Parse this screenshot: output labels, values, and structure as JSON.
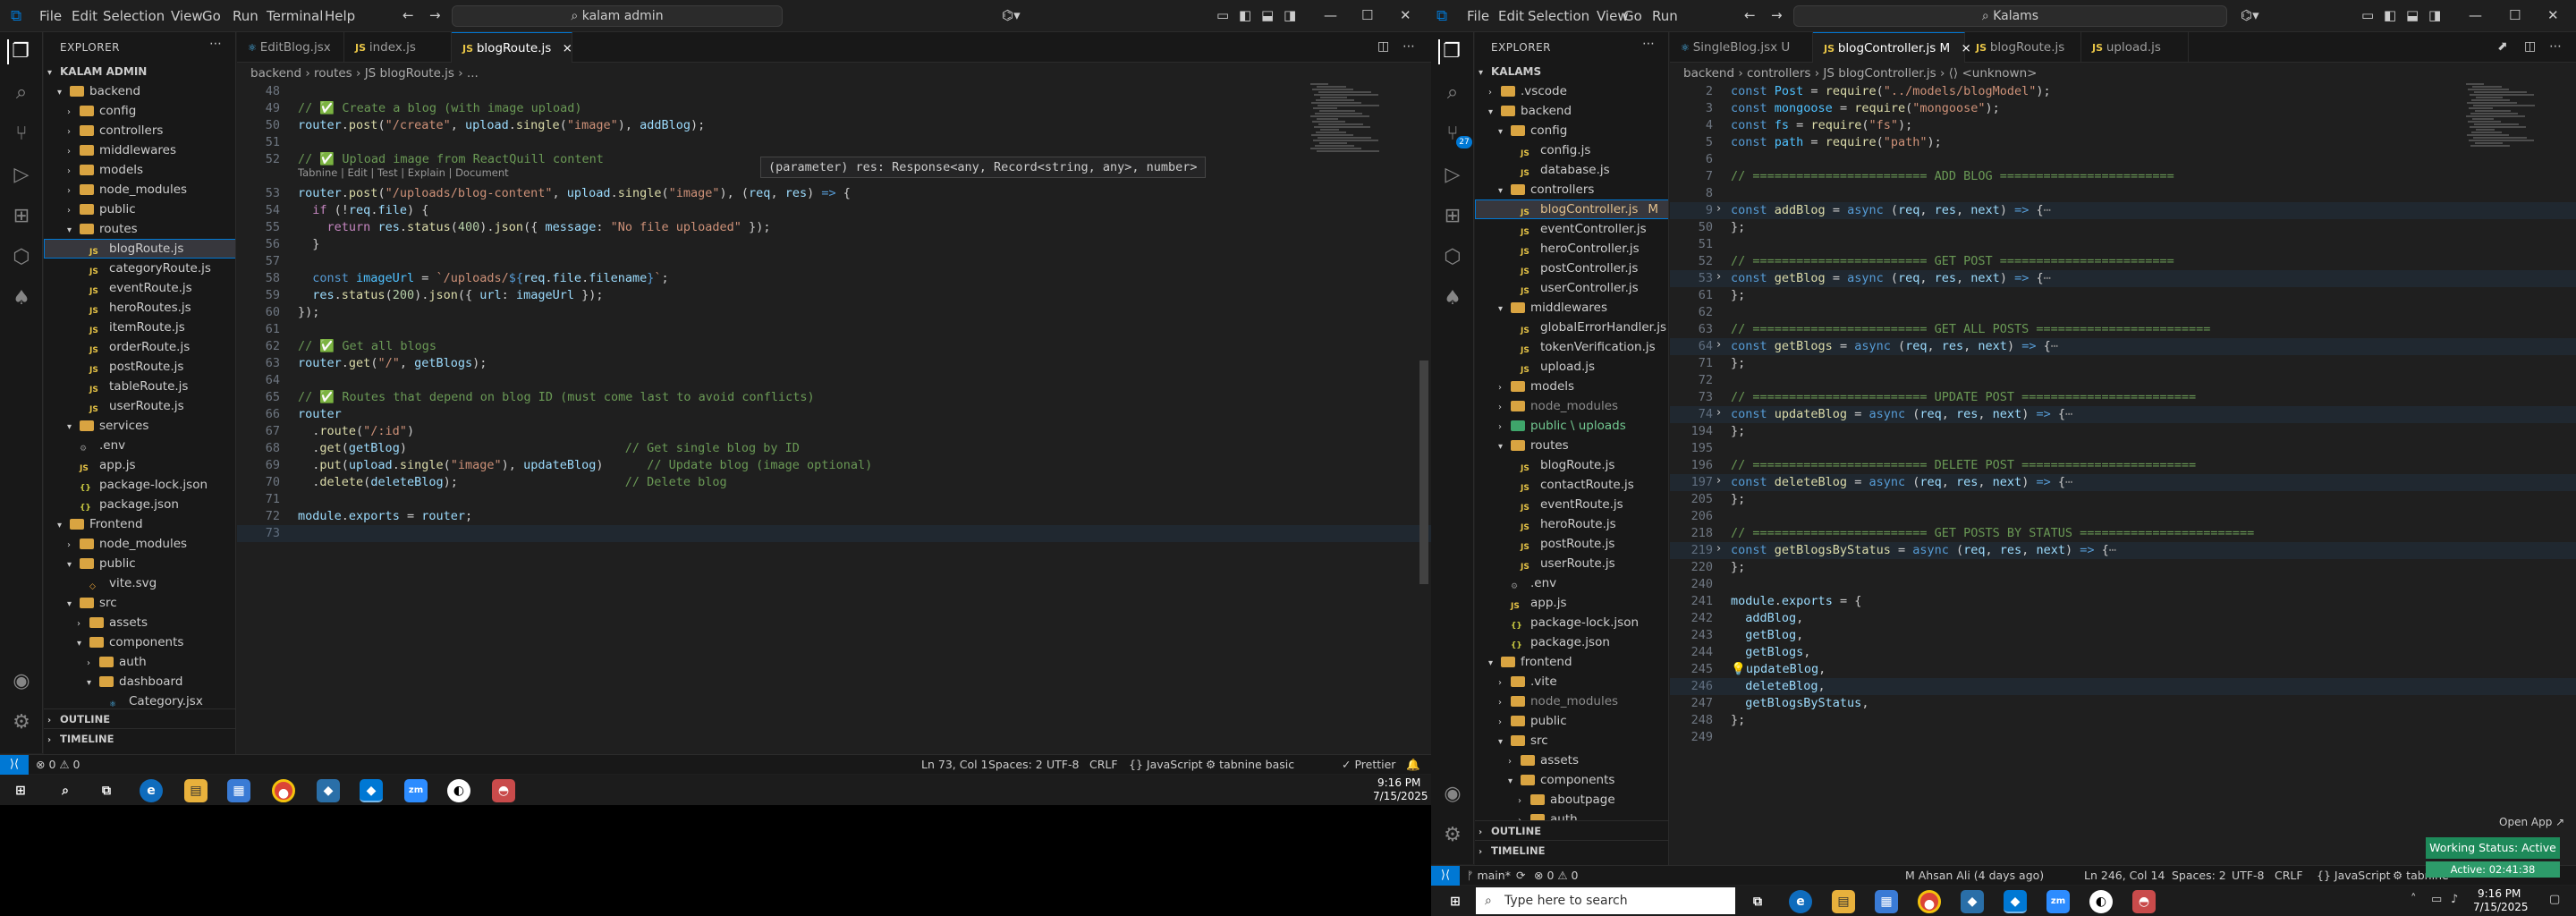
{
  "left": {
    "menu": [
      "File",
      "Edit",
      "Selection",
      "View",
      "Go",
      "Run",
      "Terminal",
      "Help"
    ],
    "search": "kalam admin",
    "explorer_title": "EXPLORER",
    "root": "KALAM ADMIN",
    "tree": [
      {
        "label": "backend",
        "depth": 1,
        "type": "folder",
        "open": true
      },
      {
        "label": "config",
        "depth": 2,
        "type": "folder"
      },
      {
        "label": "controllers",
        "depth": 2,
        "type": "folder"
      },
      {
        "label": "middlewares",
        "depth": 2,
        "type": "folder"
      },
      {
        "label": "models",
        "depth": 2,
        "type": "folder"
      },
      {
        "label": "node_modules",
        "depth": 2,
        "type": "folder"
      },
      {
        "label": "public",
        "depth": 2,
        "type": "folder"
      },
      {
        "label": "routes",
        "depth": 2,
        "type": "folder",
        "open": true
      },
      {
        "label": "blogRoute.js",
        "depth": 3,
        "type": "js",
        "selected": true
      },
      {
        "label": "categoryRoute.js",
        "depth": 3,
        "type": "js"
      },
      {
        "label": "eventRoute.js",
        "depth": 3,
        "type": "js"
      },
      {
        "label": "heroRoutes.js",
        "depth": 3,
        "type": "js"
      },
      {
        "label": "itemRoute.js",
        "depth": 3,
        "type": "js"
      },
      {
        "label": "orderRoute.js",
        "depth": 3,
        "type": "js"
      },
      {
        "label": "postRoute.js",
        "depth": 3,
        "type": "js"
      },
      {
        "label": "tableRoute.js",
        "depth": 3,
        "type": "js"
      },
      {
        "label": "userRoute.js",
        "depth": 3,
        "type": "js"
      },
      {
        "label": "services",
        "depth": 2,
        "type": "folder",
        "open": true
      },
      {
        "label": ".env",
        "depth": 2,
        "type": "env"
      },
      {
        "label": "app.js",
        "depth": 2,
        "type": "js"
      },
      {
        "label": "package-lock.json",
        "depth": 2,
        "type": "json"
      },
      {
        "label": "package.json",
        "depth": 2,
        "type": "json"
      },
      {
        "label": "Frontend",
        "depth": 1,
        "type": "folder",
        "open": true
      },
      {
        "label": "node_modules",
        "depth": 2,
        "type": "folder"
      },
      {
        "label": "public",
        "depth": 2,
        "type": "folder",
        "open": true
      },
      {
        "label": "vite.svg",
        "depth": 3,
        "type": "svg"
      },
      {
        "label": "src",
        "depth": 2,
        "type": "folder",
        "open": true
      },
      {
        "label": "assets",
        "depth": 3,
        "type": "folder"
      },
      {
        "label": "components",
        "depth": 3,
        "type": "folder",
        "open": true
      },
      {
        "label": "auth",
        "depth": 4,
        "type": "folder"
      },
      {
        "label": "dashboard",
        "depth": 4,
        "type": "folder",
        "open": true
      },
      {
        "label": "Category.jsx",
        "depth": 5,
        "type": "jsx"
      }
    ],
    "outline": "OUTLINE",
    "timeline": "TIMELINE",
    "tabs": [
      {
        "label": "EditBlog.jsx",
        "type": "jsx"
      },
      {
        "label": "index.js",
        "type": "js"
      },
      {
        "label": "blogRoute.js",
        "type": "js",
        "active": true,
        "close": "×"
      }
    ],
    "breadcrumb": "backend › routes › JS blogRoute.js › ...",
    "codelens": "Tabnine | Edit | Test | Explain | Document",
    "tooltip": "(parameter) res: Response<any, Record<string, any>, number>",
    "line_numbers": [
      "48",
      "49",
      "50",
      "51",
      "52",
      "53",
      "54",
      "55",
      "56",
      "57",
      "58",
      "59",
      "60",
      "61",
      "62",
      "63",
      "64",
      "65",
      "66",
      "67",
      "68",
      "69",
      "70",
      "71",
      "72",
      "73"
    ],
    "status": {
      "problems": "⊗ 0 ⚠ 0",
      "position": "Ln 73, Col 1",
      "spaces": "Spaces: 2",
      "encoding": "UTF-8",
      "eol": "CRLF",
      "lang": "{} JavaScript",
      "tabnine": "⚙ tabnine basic",
      "prettier": "✓ Prettier"
    },
    "clock_time": "9:16 PM",
    "clock_date": "7/15/2025"
  },
  "right": {
    "menu": [
      "File",
      "Edit",
      "Selection",
      "View",
      "Go",
      "Run"
    ],
    "search": "Kalams",
    "explorer_title": "EXPLORER",
    "root": "KALAMS",
    "tree": [
      {
        "label": ".vscode",
        "depth": 1,
        "type": "folder"
      },
      {
        "label": "backend",
        "depth": 1,
        "type": "folder",
        "open": true
      },
      {
        "label": "config",
        "depth": 2,
        "type": "folder",
        "open": true
      },
      {
        "label": "config.js",
        "depth": 3,
        "type": "js"
      },
      {
        "label": "database.js",
        "depth": 3,
        "type": "js"
      },
      {
        "label": "controllers",
        "depth": 2,
        "type": "folder",
        "open": true
      },
      {
        "label": "blogController.js",
        "depth": 3,
        "type": "js",
        "selected": true,
        "badge": "M"
      },
      {
        "label": "eventController.js",
        "depth": 3,
        "type": "js"
      },
      {
        "label": "heroController.js",
        "depth": 3,
        "type": "js"
      },
      {
        "label": "postController.js",
        "depth": 3,
        "type": "js"
      },
      {
        "label": "userController.js",
        "depth": 3,
        "type": "js"
      },
      {
        "label": "middlewares",
        "depth": 2,
        "type": "folder",
        "open": true
      },
      {
        "label": "globalErrorHandler.js",
        "depth": 3,
        "type": "js"
      },
      {
        "label": "tokenVerification.js",
        "depth": 3,
        "type": "js"
      },
      {
        "label": "upload.js",
        "depth": 3,
        "type": "js"
      },
      {
        "label": "models",
        "depth": 2,
        "type": "folder"
      },
      {
        "label": "node_modules",
        "depth": 2,
        "type": "folder",
        "dim": true
      },
      {
        "label": "public \\ uploads",
        "depth": 2,
        "type": "folder",
        "green": true
      },
      {
        "label": "routes",
        "depth": 2,
        "type": "folder",
        "open": true
      },
      {
        "label": "blogRoute.js",
        "depth": 3,
        "type": "js"
      },
      {
        "label": "contactRoute.js",
        "depth": 3,
        "type": "js"
      },
      {
        "label": "eventRoute.js",
        "depth": 3,
        "type": "js"
      },
      {
        "label": "heroRoute.js",
        "depth": 3,
        "type": "js"
      },
      {
        "label": "postRoute.js",
        "depth": 3,
        "type": "js"
      },
      {
        "label": "userRoute.js",
        "depth": 3,
        "type": "js"
      },
      {
        "label": ".env",
        "depth": 2,
        "type": "env"
      },
      {
        "label": "app.js",
        "depth": 2,
        "type": "js"
      },
      {
        "label": "package-lock.json",
        "depth": 2,
        "type": "json"
      },
      {
        "label": "package.json",
        "depth": 2,
        "type": "json"
      },
      {
        "label": "frontend",
        "depth": 1,
        "type": "folder",
        "open": true
      },
      {
        "label": ".vite",
        "depth": 2,
        "type": "folder"
      },
      {
        "label": "node_modules",
        "depth": 2,
        "type": "folder",
        "dim": true
      },
      {
        "label": "public",
        "depth": 2,
        "type": "folder"
      },
      {
        "label": "src",
        "depth": 2,
        "type": "folder",
        "open": true
      },
      {
        "label": "assets",
        "depth": 3,
        "type": "folder"
      },
      {
        "label": "components",
        "depth": 3,
        "type": "folder",
        "open": true
      },
      {
        "label": "aboutpage",
        "depth": 4,
        "type": "folder"
      },
      {
        "label": "auth",
        "depth": 4,
        "type": "folder"
      }
    ],
    "outline": "OUTLINE",
    "timeline": "TIMELINE",
    "tabs": [
      {
        "label": "SingleBlog.jsx U",
        "type": "jsx"
      },
      {
        "label": "blogController.js M",
        "type": "js",
        "active": true,
        "close": "×"
      },
      {
        "label": "blogRoute.js",
        "type": "js"
      },
      {
        "label": "upload.js",
        "type": "js"
      }
    ],
    "breadcrumb": "backend › controllers › JS blogController.js › ⟨⟩ <unknown>",
    "line_numbers": [
      "2",
      "3",
      "4",
      "5",
      "6",
      "7",
      "8",
      "9",
      "50",
      "51",
      "52",
      "53",
      "61",
      "62",
      "63",
      "64",
      "71",
      "72",
      "73",
      "74",
      "194",
      "195",
      "196",
      "197",
      "205",
      "206",
      "218",
      "219",
      "220",
      "240",
      "241",
      "242",
      "243",
      "244",
      "245",
      "246",
      "247",
      "248",
      "249"
    ],
    "status": {
      "branch": "ᚠ main*",
      "sync": "⟳",
      "problems": "⊗ 0 ⚠ 0",
      "blame": "M Ahsan Ali (4 days ago)",
      "position": "Ln 246, Col 14",
      "spaces": "Spaces: 2",
      "encoding": "UTF-8",
      "eol": "CRLF",
      "lang": "{} JavaScript",
      "tabnine": "⚙ tabnine"
    },
    "notif_open": "Open App ↗",
    "notif_status": "Working Status: Active",
    "notif_time": "Active: 02:41:38",
    "taskbar_search": "Type here to search",
    "clock_time": "9:16 PM",
    "clock_date": "7/15/2025"
  },
  "colors": {
    "accent": "#0078d4",
    "bg": "#1f1f1f",
    "sidebar": "#181818",
    "string": "#ce9178",
    "keyword": "#569cd6",
    "comment": "#6a9955",
    "function": "#dcdcaa",
    "variable": "#9cdcfe",
    "notif_green": "#1e8a5a"
  },
  "icons": [
    "explorer-icon",
    "search-icon",
    "source-control-icon",
    "run-debug-icon",
    "extensions-icon",
    "remote-icon",
    "mongodb-icon",
    "account-icon",
    "gear-icon",
    "windows-start-icon",
    "task-view-icon",
    "edge-icon",
    "file-explorer-icon",
    "store-icon",
    "chrome-icon",
    "vscode-icon",
    "zoom-icon"
  ]
}
